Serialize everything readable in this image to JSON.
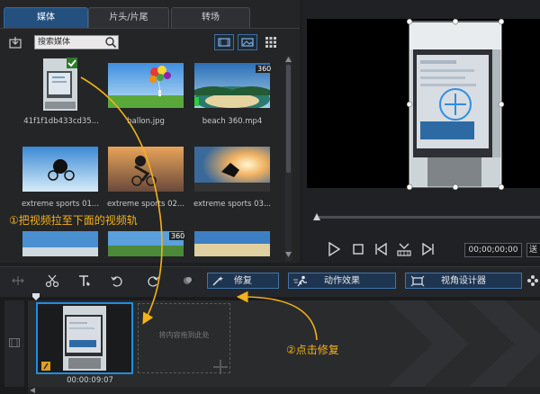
{
  "media_panel": {
    "tabs": [
      {
        "label": "媒体",
        "active": true
      },
      {
        "label": "片头/片尾",
        "active": false
      },
      {
        "label": "转场",
        "active": false
      }
    ],
    "search_placeholder": "搜索媒体",
    "items": [
      {
        "label": "41f1f1db433cd35..."
      },
      {
        "label": "ballon.jpg"
      },
      {
        "label": "beach 360.mp4",
        "badge": "360"
      },
      {
        "label": "extreme sports 01..."
      },
      {
        "label": "extreme sports 02..."
      },
      {
        "label": "extreme sports 03..."
      },
      {
        "label": ""
      },
      {
        "label": "",
        "badge": "360"
      },
      {
        "label": ""
      }
    ]
  },
  "preview": {
    "timecode": "00;00;00;00",
    "right_cut_text": "送"
  },
  "timeline_toolbar": {
    "fix_label": "修复",
    "motion_label": "动作效果",
    "viewport_label": "视角设计器"
  },
  "timeline": {
    "clip_time": "00:00:09:07",
    "drop_text": "将内容拖到此处"
  },
  "annotations": {
    "step1": "①把视频拉至下面的视频轨",
    "step2": "②点击修复"
  },
  "colors": {
    "accent_blue": "#1f8ee0",
    "annotation_orange": "#f3b21a",
    "tab_active": "#23507e"
  }
}
